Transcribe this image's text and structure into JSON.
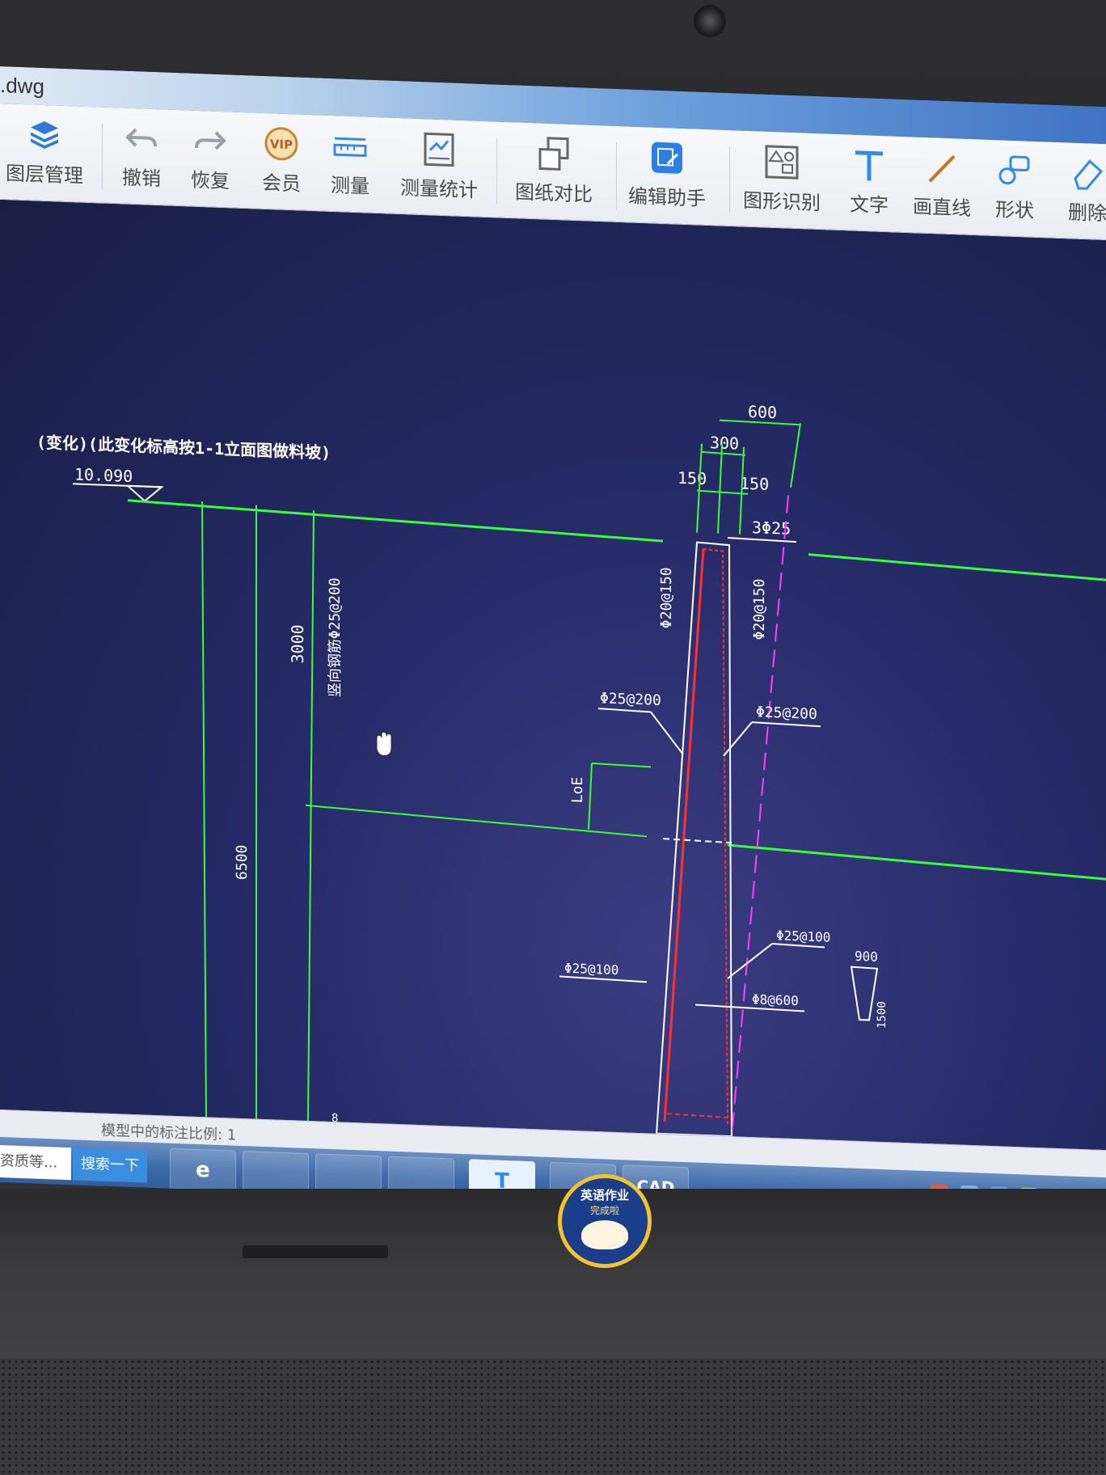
{
  "window": {
    "title": ".dwg"
  },
  "toolbar": {
    "items": [
      {
        "label": "图层管理",
        "icon": "layers-icon"
      },
      {
        "label": "撤销",
        "icon": "undo-icon"
      },
      {
        "label": "恢复",
        "icon": "redo-icon"
      },
      {
        "label": "会员",
        "icon": "vip-icon"
      },
      {
        "label": "测量",
        "icon": "measure-icon"
      },
      {
        "label": "测量统计",
        "icon": "measure-stats-icon"
      },
      {
        "label": "图纸对比",
        "icon": "compare-icon"
      },
      {
        "label": "编辑助手",
        "icon": "edit-assistant-icon"
      },
      {
        "label": "图形识别",
        "icon": "shape-recognition-icon"
      },
      {
        "label": "文字",
        "icon": "text-icon"
      },
      {
        "label": "画直线",
        "icon": "line-icon"
      },
      {
        "label": "形状",
        "icon": "shape-icon"
      },
      {
        "label": "删除",
        "icon": "eraser-icon"
      }
    ]
  },
  "drawing": {
    "header_note": "(变化)(此变化标高按1-1立面图做料坡)",
    "elevation": "10.090",
    "dim_top": "600",
    "dim_mid": "300",
    "dim_left": "150",
    "dim_right": "150",
    "rebar_top": "3Φ25",
    "rebar_left_upper": "Φ20@150",
    "rebar_right_upper": "Φ20@150",
    "rebar_left_mid": "Φ25@200",
    "rebar_right_mid": "Φ25@200",
    "dim_vertical_3000": "3000",
    "rebar_vertical_note": "竖向钢筋Φ25@200",
    "dim_vertical_6500": "6500",
    "loe_label": "LoE",
    "rebar_right_lower": "Φ25@100",
    "rebar_left_lower": "Φ25@100",
    "rebar_bottom": "Φ8@600",
    "dim_900": "900",
    "dim_1500": "1500",
    "dim_small_8": "8"
  },
  "statusbar": {
    "scale_text": "模型中的标注比例: 1"
  },
  "taskbar": {
    "search_text": "资质等...",
    "search_button": "搜索一下",
    "apps": [
      {
        "label": "e",
        "icon": "ie-icon"
      },
      {
        "label": "",
        "icon": "app-icon"
      },
      {
        "label": "",
        "icon": "chat-icon"
      },
      {
        "label": "",
        "icon": "folder-icon"
      },
      {
        "label": "T",
        "icon": "text-app-icon"
      },
      {
        "label": "",
        "icon": "media-icon"
      },
      {
        "label": "CAD",
        "icon": "cad-icon"
      }
    ]
  },
  "sticker": {
    "line1": "英语作业",
    "line2": "完成啦"
  },
  "colors": {
    "canvas_bg": "#232866",
    "cad_green": "#39ff39",
    "cad_red": "#ff3030",
    "cad_magenta": "#ff40ff",
    "cad_white": "#ffffff"
  }
}
